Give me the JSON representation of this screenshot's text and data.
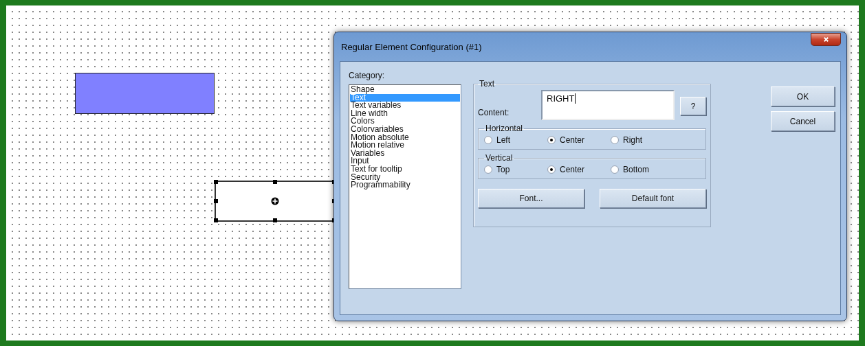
{
  "canvas_elements": [
    {
      "kind": "rectangle",
      "filled": true,
      "selected": false
    },
    {
      "kind": "rectangle",
      "filled": false,
      "selected": true
    }
  ],
  "dialog": {
    "title": "Regular Element Configuration (#1)",
    "category_label": "Category:",
    "categories": [
      {
        "label": "Shape",
        "selected": false
      },
      {
        "label": "Text",
        "selected": true
      },
      {
        "label": "Text variables",
        "selected": false
      },
      {
        "label": "Line width",
        "selected": false
      },
      {
        "label": "Colors",
        "selected": false
      },
      {
        "label": "Colorvariables",
        "selected": false
      },
      {
        "label": "Motion absolute",
        "selected": false
      },
      {
        "label": "Motion relative",
        "selected": false
      },
      {
        "label": "Variables",
        "selected": false
      },
      {
        "label": "Input",
        "selected": false
      },
      {
        "label": "Text for tooltip",
        "selected": false
      },
      {
        "label": "Security",
        "selected": false
      },
      {
        "label": "Programmability",
        "selected": false
      }
    ],
    "text_group": {
      "title": "Text",
      "content_label": "Content:",
      "content_value": "RIGHT",
      "help_button": "?",
      "horizontal": {
        "title": "Horizontal",
        "options": [
          {
            "label": "Left",
            "selected": false
          },
          {
            "label": "Center",
            "selected": true
          },
          {
            "label": "Right",
            "selected": false
          }
        ]
      },
      "vertical": {
        "title": "Vertical",
        "options": [
          {
            "label": "Top",
            "selected": false
          },
          {
            "label": "Center",
            "selected": true
          },
          {
            "label": "Bottom",
            "selected": false
          }
        ]
      },
      "font_button": "Font...",
      "default_font_button": "Default font"
    },
    "buttons": [
      "OK",
      "Cancel"
    ]
  }
}
